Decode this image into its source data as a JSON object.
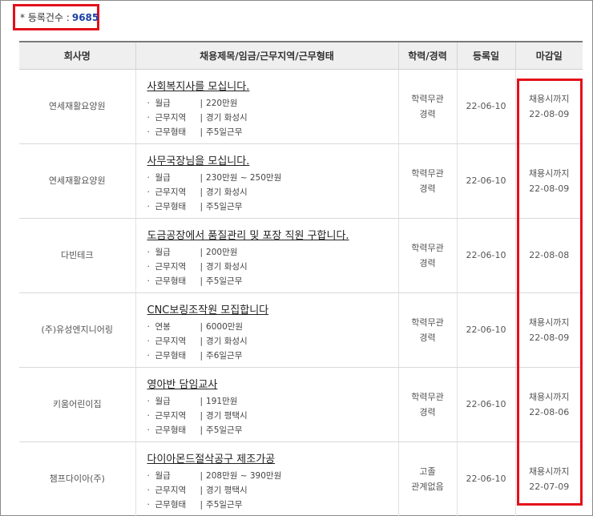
{
  "summary": {
    "label": "* 등록건수 :",
    "count": "9685"
  },
  "table": {
    "headers": [
      "회사명",
      "채용제목/임금/근무지역/근무형태",
      "학력/경력",
      "등록일",
      "마감일"
    ],
    "rows": [
      {
        "company": "연세재활요양원",
        "title": "사회복지사를 모십니다.",
        "details": [
          {
            "key": "월급",
            "value": "220만원"
          },
          {
            "key": "근무지역",
            "value": "경기 화성시"
          },
          {
            "key": "근무형태",
            "value": "주5일근무"
          }
        ],
        "edu": [
          "학력무관",
          "경력"
        ],
        "reg_date": "22-06-10",
        "deadline": [
          "채용시까지",
          "22-08-09"
        ]
      },
      {
        "company": "연세재활요양원",
        "title": "사무국장님을 모십니다.",
        "details": [
          {
            "key": "월급",
            "value": "230만원 ~ 250만원"
          },
          {
            "key": "근무지역",
            "value": "경기 화성시"
          },
          {
            "key": "근무형태",
            "value": "주5일근무"
          }
        ],
        "edu": [
          "학력무관",
          "경력"
        ],
        "reg_date": "22-06-10",
        "deadline": [
          "채용시까지",
          "22-08-09"
        ]
      },
      {
        "company": "다빈테크",
        "title": "도금공장에서 품질관리 및 포장 직원 구합니다.",
        "details": [
          {
            "key": "월급",
            "value": "200만원"
          },
          {
            "key": "근무지역",
            "value": "경기 화성시"
          },
          {
            "key": "근무형태",
            "value": "주5일근무"
          }
        ],
        "edu": [
          "학력무관",
          "경력"
        ],
        "reg_date": "22-06-10",
        "deadline": [
          "22-08-08"
        ]
      },
      {
        "company": "(주)유성엔지니어링",
        "title": "CNC보링조작원 모집합니다",
        "details": [
          {
            "key": "연봉",
            "value": "6000만원"
          },
          {
            "key": "근무지역",
            "value": "경기 화성시"
          },
          {
            "key": "근무형태",
            "value": "주6일근무"
          }
        ],
        "edu": [
          "학력무관",
          "경력"
        ],
        "reg_date": "22-06-10",
        "deadline": [
          "채용시까지",
          "22-08-09"
        ]
      },
      {
        "company": "키움어린이집",
        "title": "영아반 담임교사",
        "details": [
          {
            "key": "월급",
            "value": "191만원"
          },
          {
            "key": "근무지역",
            "value": "경기 평택시"
          },
          {
            "key": "근무형태",
            "value": "주5일근무"
          }
        ],
        "edu": [
          "학력무관",
          "경력"
        ],
        "reg_date": "22-06-10",
        "deadline": [
          "채용시까지",
          "22-08-06"
        ]
      },
      {
        "company": "챔프다이아(주)",
        "title": "다이아몬드절삭공구 제조가공",
        "details": [
          {
            "key": "월급",
            "value": "208만원 ~ 390만원"
          },
          {
            "key": "근무지역",
            "value": "경기 평택시"
          },
          {
            "key": "근무형태",
            "value": "주5일근무"
          }
        ],
        "edu": [
          "고졸",
          "관계없음"
        ],
        "reg_date": "22-06-10",
        "deadline": [
          "채용시까지",
          "22-07-09"
        ]
      }
    ]
  }
}
